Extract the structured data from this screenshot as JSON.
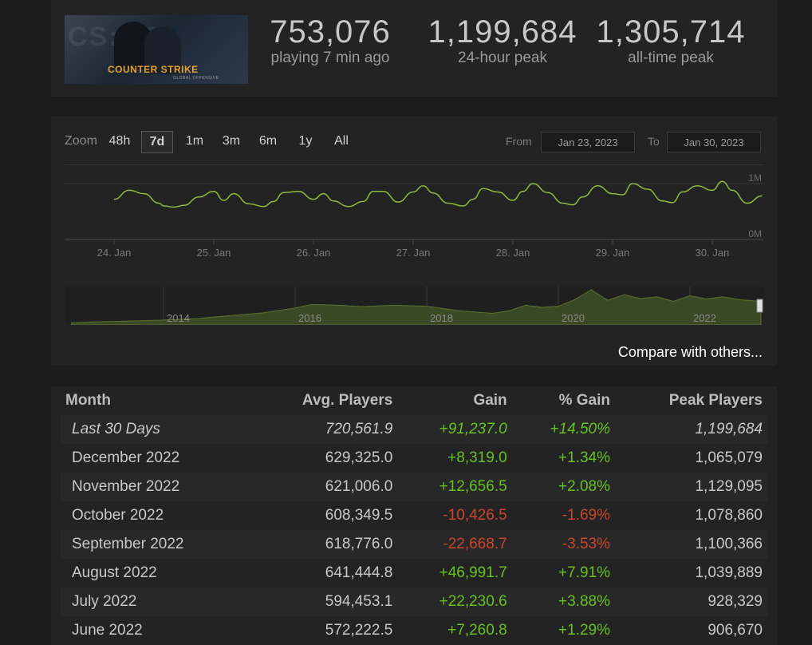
{
  "header": {
    "logo_text": "COUNTER STRIKE",
    "logo_subtext": "GLOBAL OFFENSIVE",
    "current": {
      "value": "753,076",
      "label": "playing 7 min ago"
    },
    "peak_24h": {
      "value": "1,199,684",
      "label": "24-hour peak"
    },
    "peak_alltime": {
      "value": "1,305,714",
      "label": "all-time peak"
    }
  },
  "controls": {
    "zoom_label": "Zoom",
    "zoom_options": [
      "48h",
      "7d",
      "1m",
      "3m",
      "6m",
      "1y",
      "All"
    ],
    "selected_zoom": "7d",
    "from_label": "From",
    "from_value": "Jan 23, 2023",
    "to_label": "To",
    "to_value": "Jan 30, 2023"
  },
  "chart_data": [
    {
      "type": "line",
      "x_categories": [
        "24. Jan",
        "25. Jan",
        "26. Jan",
        "27. Jan",
        "28. Jan",
        "29. Jan",
        "30. Jan"
      ],
      "y_tick_labels": [
        "1M",
        "0M"
      ],
      "ylim": [
        0,
        1200000
      ],
      "grid": true,
      "series": [
        {
          "x": [
            0,
            0.15,
            0.3,
            0.45,
            0.5,
            0.6,
            0.7,
            0.85,
            1.0,
            1.1,
            1.2,
            1.35,
            1.5,
            1.6,
            1.7,
            1.85,
            2.0,
            2.1,
            2.2,
            2.35,
            2.5,
            2.6,
            2.7,
            2.85,
            3.0,
            3.1,
            3.2,
            3.35,
            3.5,
            3.6,
            3.7,
            3.85,
            4.0,
            4.1,
            4.2,
            4.35,
            4.5,
            4.6,
            4.7,
            4.85,
            5.0,
            5.1,
            5.2,
            5.35,
            5.5,
            5.6,
            5.7,
            5.85,
            6.0,
            6.1,
            6.2,
            6.35,
            6.5
          ],
          "y": [
            720000,
            880000,
            820000,
            650000,
            600000,
            580000,
            610000,
            760000,
            860000,
            700000,
            820000,
            640000,
            590000,
            680000,
            840000,
            860000,
            720000,
            820000,
            690000,
            590000,
            680000,
            860000,
            860000,
            670000,
            850000,
            960000,
            830000,
            650000,
            600000,
            720000,
            910000,
            850000,
            700000,
            860000,
            1000000,
            840000,
            650000,
            620000,
            760000,
            960000,
            820000,
            800000,
            1000000,
            900000,
            690000,
            660000,
            850000,
            960000,
            880000,
            1040000,
            880000,
            650000,
            780000
          ]
        }
      ]
    },
    {
      "type": "area",
      "x_tick_labels": [
        "2014",
        "2016",
        "2018",
        "2020",
        "2022"
      ],
      "x": [
        2012.6,
        2013.0,
        2013.5,
        2014.0,
        2014.5,
        2015.0,
        2015.5,
        2016.0,
        2016.25,
        2016.5,
        2016.75,
        2017.0,
        2017.5,
        2018.0,
        2018.5,
        2019.0,
        2019.25,
        2019.5,
        2019.75,
        2020.0,
        2020.25,
        2020.5,
        2020.75,
        2021.0,
        2021.25,
        2021.5,
        2021.75,
        2022.0,
        2022.25,
        2022.5,
        2022.75,
        2023.0,
        2023.08
      ],
      "y": [
        0.06,
        0.09,
        0.11,
        0.14,
        0.18,
        0.26,
        0.34,
        0.48,
        0.58,
        0.57,
        0.55,
        0.52,
        0.56,
        0.53,
        0.4,
        0.33,
        0.4,
        0.56,
        0.5,
        0.53,
        0.72,
        1.0,
        0.7,
        0.86,
        0.75,
        0.8,
        0.67,
        0.83,
        0.74,
        0.8,
        0.72,
        0.68,
        0.7
      ],
      "ylim": [
        0,
        1.0
      ]
    }
  ],
  "compare_link": "Compare with others...",
  "table": {
    "headers": [
      "Month",
      "Avg. Players",
      "Gain",
      "% Gain",
      "Peak Players"
    ],
    "rows": [
      {
        "month": "Last 30 Days",
        "avg": "720,561.9",
        "gain": "+91,237.0",
        "pct": "+14.50%",
        "peak": "1,199,684"
      },
      {
        "month": "December 2022",
        "avg": "629,325.0",
        "gain": "+8,319.0",
        "pct": "+1.34%",
        "peak": "1,065,079"
      },
      {
        "month": "November 2022",
        "avg": "621,006.0",
        "gain": "+12,656.5",
        "pct": "+2.08%",
        "peak": "1,129,095"
      },
      {
        "month": "October 2022",
        "avg": "608,349.5",
        "gain": "-10,426.5",
        "pct": "-1.69%",
        "peak": "1,078,860"
      },
      {
        "month": "September 2022",
        "avg": "618,776.0",
        "gain": "-22,668.7",
        "pct": "-3.53%",
        "peak": "1,100,366"
      },
      {
        "month": "August 2022",
        "avg": "641,444.8",
        "gain": "+46,991.7",
        "pct": "+7.91%",
        "peak": "1,039,889"
      },
      {
        "month": "July 2022",
        "avg": "594,453.1",
        "gain": "+22,230.6",
        "pct": "+3.88%",
        "peak": "928,329"
      },
      {
        "month": "June 2022",
        "avg": "572,222.5",
        "gain": "+7,260.8",
        "pct": "+1.29%",
        "peak": "906,670"
      }
    ]
  },
  "colors": {
    "line": "#8fb93b",
    "area": "#3a4a26",
    "positive": "#66c020",
    "negative": "#c9452b"
  }
}
